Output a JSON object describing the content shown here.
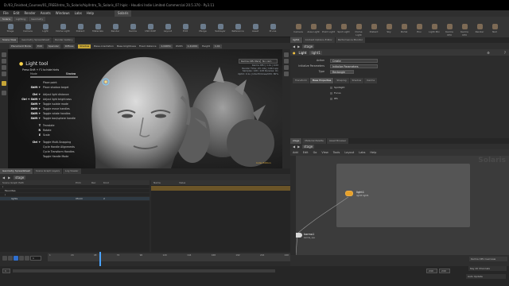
{
  "window": {
    "title": "D:/03_Finished_Courses/01_FREE/Intro_To_Solaris/hip/Intro_To_Solaris_07.hiplc - Houdini Indie Limited-Commercial 20.5.370 - Py3.11"
  },
  "menu": [
    "File",
    "Edit",
    "Render",
    "Assets",
    "Windows",
    "Labs",
    "Help"
  ],
  "desk": "Solaris",
  "shelf_tabs": [
    "Solaris",
    "Lighting",
    "Geometry"
  ],
  "shelf_tools": [
    "Stage",
    "Camera",
    "Light",
    "Dome Light",
    "Distant",
    "Materials",
    "Render",
    "Karma",
    "USD ROP",
    "Layout",
    "Edit",
    "Merge",
    "Sublayer",
    "Reference",
    "Asset",
    "Prune"
  ],
  "right_shelf_tools": [
    "Camera",
    "Area Light",
    "Point Light",
    "Spot Light",
    "Dome Light",
    "Distant",
    "Sky",
    "Portal",
    "Env",
    "Light Mix",
    "Karma XPU",
    "Karma CPU",
    "Render",
    "Null"
  ],
  "left_tabs": [
    "Scene View",
    "Geometry Spreadsheet",
    "Render Gallery"
  ],
  "vp_toolbar": [
    "Placement Mode",
    "Edit",
    "Specular",
    "Diffuse",
    "Shadow",
    "Base orientation",
    "Base brightness",
    "Fixed distance",
    "Width",
    "Height"
  ],
  "vp_values": {
    "fixed_distance": "1.04651",
    "width": "1.41264",
    "height": "1.41"
  },
  "renderer": "Karma XPU Persp",
  "camera": "No cam",
  "stats": [
    "Karma XPU | 1.2s | 0.00",
    "Render Time: 2m 14s | 1024 spp",
    "Samples: 128 / 128  Denoise: On",
    "OptiX: 0.1s | Intel Embree/CPU: 80%"
  ],
  "hud": {
    "title": "Light tool",
    "subtitle": "Press Shift + F1 to hide hints",
    "mode_label": "Mode",
    "mode_value": "Shadow",
    "rows": [
      {
        "key": "",
        "desc": "Place point"
      },
      {
        "key": "Shift +",
        "desc": "Place shadow target"
      },
      {
        "key": "Ctrl +",
        "desc": "Adjust light distance"
      },
      {
        "key": "Ctrl + Shift +",
        "desc": "Adjust light brightness"
      },
      {
        "key": "Shift +",
        "desc": "Toggle isolate mode"
      },
      {
        "key": "Shift +",
        "desc": "Toggle move handles"
      },
      {
        "key": "Shift +",
        "desc": "Toggle rotate handles"
      },
      {
        "key": "Shift +",
        "desc": "Toggle box/sphere handle"
      },
      {
        "key": "T",
        "desc": "Translate"
      },
      {
        "key": "R",
        "desc": "Rotate"
      },
      {
        "key": "E",
        "desc": "Scale"
      },
      {
        "key": "Ctrl +",
        "desc": "Toggle Multi-Snapping"
      },
      {
        "key": "",
        "desc": "Cycle Handle Alignments"
      },
      {
        "key": "",
        "desc": "Cycle Transform Handles"
      },
      {
        "key": "",
        "desc": "Toggle Handle Mode"
      }
    ]
  },
  "viewport_badge": "Indie Edition",
  "lower_tabs": [
    "Geometry Spreadsheet",
    "Scene Graph Layers",
    "Log Viewer"
  ],
  "lower_path": "stage",
  "scene_tree": {
    "headers": [
      "Scene Graph Path",
      "Prim",
      "Rec",
      "Kind"
    ],
    "rows": [
      {
        "name": "/",
        "prim": "",
        "kind": ""
      },
      {
        "name": "Favorites",
        "prim": "",
        "kind": ""
      },
      {
        "name": "/",
        "prim": "",
        "kind": ""
      },
      {
        "name": "lights",
        "prim": "Xform",
        "kind": "2"
      }
    ]
  },
  "properties": {
    "headers": [
      "Name",
      "Value"
    ]
  },
  "timeline": {
    "frame": "1",
    "ticks": [
      "1",
      "24",
      "48",
      "72",
      "96",
      "120",
      "144",
      "168",
      "192",
      "216",
      "240"
    ],
    "end_a": "240",
    "end_b": "240",
    "start": "1"
  },
  "right_tabs": [
    "light1",
    "Context Options Editor",
    "Performance Monitor"
  ],
  "right_path": "stage",
  "light_node": {
    "type": "Light",
    "name": "light1"
  },
  "params": [
    {
      "label": "Action",
      "value": "Create"
    },
    {
      "label": "Initialize Parameters",
      "value": "Initialize Parameters"
    },
    {
      "label": "Type",
      "value": "Rectangle"
    }
  ],
  "param_tabs": [
    "Transform",
    "Base Properties",
    "Shaping",
    "Shadow",
    "Karma"
  ],
  "param_checks": [
    "Spotlight",
    "Focus",
    "IES"
  ],
  "network_tabs": [
    "stage",
    "Material Palette",
    "Asset Browser"
  ],
  "network_path": "stage",
  "network_menu": [
    "Add",
    "Edit",
    "Go",
    "View",
    "Tools",
    "Layout",
    "Labs",
    "Help"
  ],
  "network_watermark": "Solaris",
  "nodes": [
    {
      "name": "light1",
      "sub": "light3 light1",
      "color": "#e7a12a"
    },
    {
      "name": "karma1",
      "sub": "karma_xpu",
      "color": "#d8d8d8"
    }
  ],
  "status": {
    "left": "Auto Update",
    "right1": "Karma XPU overview",
    "right2": "Key All Channels"
  }
}
